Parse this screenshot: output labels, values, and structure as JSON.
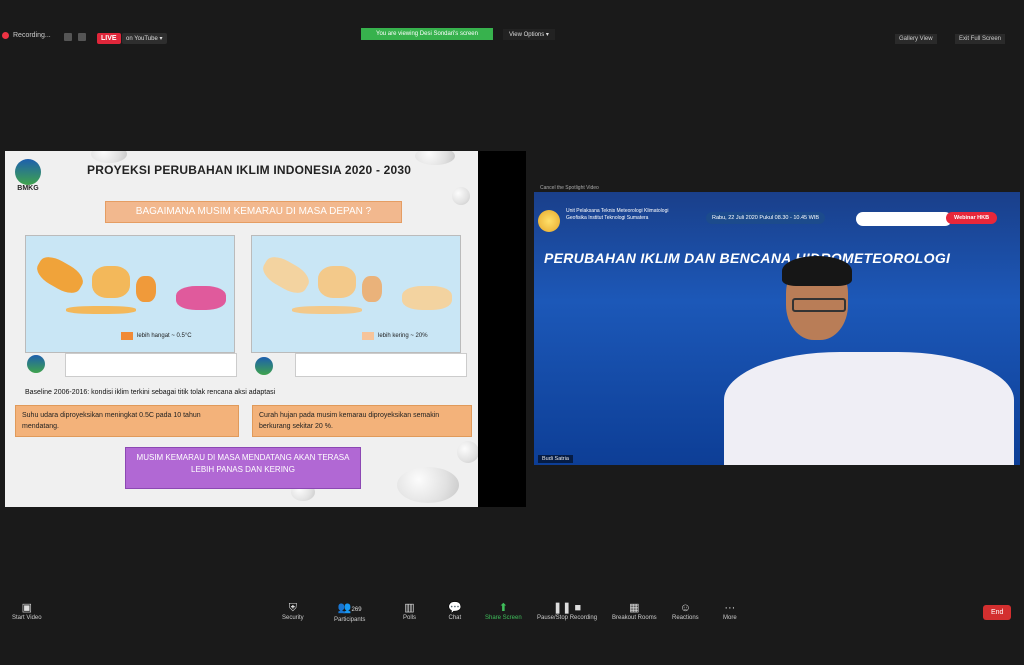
{
  "top_bar": {
    "recording_label": "Recording...",
    "live_label": "LIVE",
    "youtube_label": "on YouTube ▾",
    "viewing_banner": "You are viewing Desi Sondari's screen",
    "view_options_label": "View Options ▾",
    "gallery_view_label": "Gallery View",
    "exit_full_screen_label": "Exit Full Screen"
  },
  "slide": {
    "logo_text": "BMKG",
    "title": "PROYEKSI PERUBAHAN IKLIM INDONESIA 2020 - 2030",
    "question": "BAGAIMANA MUSIM KEMARAU DI MASA DEPAN ?",
    "map_left_legend": "lebih hangat ~ 0.5°C",
    "map_right_legend": "lebih kering ~ 20%",
    "baseline_text": "Baseline 2006-2016: kondisi iklim terkini sebagai titik tolak rencana aksi adaptasi",
    "note_left": "Suhu udara diproyeksikan meningkat 0.5C pada 10 tahun mendatang.",
    "note_right": "Curah hujan pada musim kemarau diproyeksikan semakin berkurang sekitar 20 %.",
    "conclusion": "MUSIM KEMARAU DI MASA MENDATANG AKAN TERASA LEBIH PANAS DAN KERING"
  },
  "video": {
    "cancel_spotlight": "Cancel the Spotlight Video",
    "org_text": "Unit Pelaksana Teknis Meteorologi Klimatologi Geofisika Institut Teknologi Sumatera",
    "date_text": "Rabu, 22 Juli 2020 Pukul 08.30 - 10.45 WIB",
    "webinar_label": "Webinar HKB",
    "title": "PERUBAHAN IKLIM DAN BENCANA HIDROMETEOROLOGI",
    "participant_name": "Budi Satria"
  },
  "toolbar": {
    "start_video": "Start Video",
    "security": "Security",
    "participants": "Participants",
    "participants_count": "269",
    "polls": "Polls",
    "chat": "Chat",
    "share_screen": "Share Screen",
    "pause_recording": "Pause/Stop Recording",
    "breakout_rooms": "Breakout Rooms",
    "reactions": "Reactions",
    "more": "More",
    "end": "End"
  },
  "colors": {
    "viewing_banner": "#37b24d",
    "live": "#e0263a",
    "end": "#d32f2f",
    "conclusion": "#b168d4",
    "note": "#f3b27a"
  }
}
